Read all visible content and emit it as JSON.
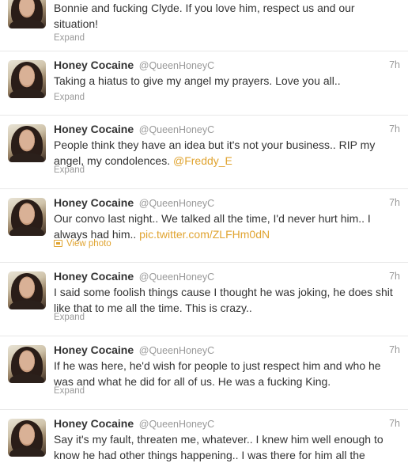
{
  "tweets": [
    {
      "name": "",
      "handle": "",
      "time": "",
      "text_parts": [
        "Bonnie and fucking Clyde. If you love him, respect us and our situation!",
        ""
      ],
      "action": "Expand"
    },
    {
      "name": "Honey Cocaine",
      "handle": "@QueenHoneyC",
      "time": "7h",
      "text_parts": [
        "Taking a hiatus to give my angel my prayers. Love you all..",
        ""
      ],
      "action": "Expand"
    },
    {
      "name": "Honey Cocaine",
      "handle": "@QueenHoneyC",
      "time": "7h",
      "text_parts": [
        "People think they have an idea but it's not your business.. RIP my angel, my condolences. ",
        "@Freddy_E"
      ],
      "action": "Expand"
    },
    {
      "name": "Honey Cocaine",
      "handle": "@QueenHoneyC",
      "time": "7h",
      "text_parts": [
        "Our convo last night.. We talked all the time, I'd never hurt him.. I always had him.. ",
        "pic.twitter.com/ZLFHm0dN"
      ],
      "action": "View photo"
    },
    {
      "name": "Honey Cocaine",
      "handle": "@QueenHoneyC",
      "time": "7h",
      "text_parts": [
        "I said some foolish things cause I thought he was joking, he does shit like that to me all the time. This is crazy..",
        ""
      ],
      "action": "Expand"
    },
    {
      "name": "Honey Cocaine",
      "handle": "@QueenHoneyC",
      "time": "7h",
      "text_parts": [
        "If he was here, he'd wish for people to just respect him and who he was and what he did for all of us. He was a fucking King.",
        ""
      ],
      "action": "Expand"
    },
    {
      "name": "Honey Cocaine",
      "handle": "@QueenHoneyC",
      "time": "7h",
      "text_parts": [
        "Say it's my fault, threaten me, whatever.. I knew him well enough to know he had other things happening.. I was there for him all the",
        ""
      ],
      "action": ""
    }
  ]
}
